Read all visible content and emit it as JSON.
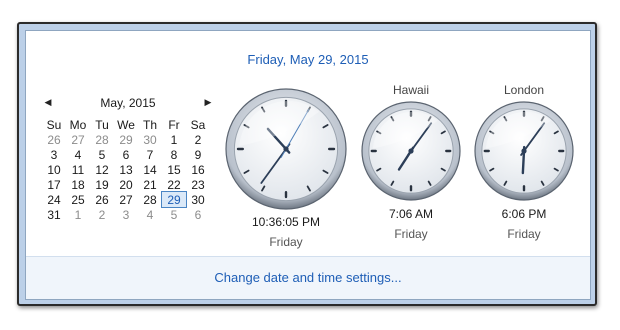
{
  "header": {
    "date": "Friday, May 29, 2015"
  },
  "calendar": {
    "month_title": "May, 2015",
    "weekdays": [
      "Su",
      "Mo",
      "Tu",
      "We",
      "Th",
      "Fr",
      "Sa"
    ],
    "weeks": [
      [
        "26",
        "27",
        "28",
        "29",
        "30",
        "1",
        "2"
      ],
      [
        "3",
        "4",
        "5",
        "6",
        "7",
        "8",
        "9"
      ],
      [
        "10",
        "11",
        "12",
        "13",
        "14",
        "15",
        "16"
      ],
      [
        "17",
        "18",
        "19",
        "20",
        "21",
        "22",
        "23"
      ],
      [
        "24",
        "25",
        "26",
        "27",
        "28",
        "29",
        "30"
      ],
      [
        "31",
        "1",
        "2",
        "3",
        "4",
        "5",
        "6"
      ]
    ],
    "selected": "29"
  },
  "clocks": [
    {
      "zone": "",
      "time": "10:36:05 PM",
      "day": "Friday",
      "hour": 22,
      "minute": 36,
      "second": 5
    },
    {
      "zone": "Hawaii",
      "time": "7:06 AM",
      "day": "Friday",
      "hour": 7,
      "minute": 6
    },
    {
      "zone": "London",
      "time": "6:06 PM",
      "day": "Friday",
      "hour": 18,
      "minute": 6
    }
  ],
  "footer": {
    "link": "Change date and time settings..."
  }
}
